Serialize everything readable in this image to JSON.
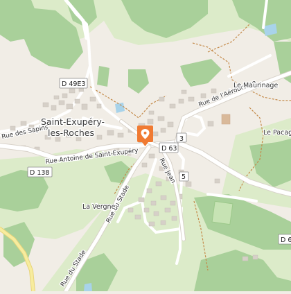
{
  "map": {
    "town_name_line1": "Saint-Exupéry-",
    "town_name_line2": "les-Roches",
    "places": {
      "maurinage": "Le Maurinage",
      "pacage": "Le Pacag",
      "vergne": "La Vergne"
    },
    "roads": {
      "aerodrome": "Rue de l'Aérodrome",
      "antoine": "Rue Antoine de Saint-Exupéry",
      "jean": "Rue Jean",
      "sapins": "Rue des Sapins",
      "stade_upper": "Rue du Stade",
      "stade_lower": "Rue du Stade"
    },
    "shields": {
      "d49e3": "D 49E3",
      "d63": "D 63",
      "d63_partial": "3",
      "d138": "D 138",
      "d6_partial": "D 6",
      "d6_small": "5"
    },
    "marker": {
      "icon": "map-pin-icon",
      "color": "#f07a32"
    },
    "colors": {
      "background": "#f1ede6",
      "forest": "#a9d09a",
      "meadow": "#dcebc9",
      "water": "#a8d3ea",
      "road": "#ffffff",
      "building": "#d6d0c8",
      "path": "#c48a4a"
    }
  }
}
